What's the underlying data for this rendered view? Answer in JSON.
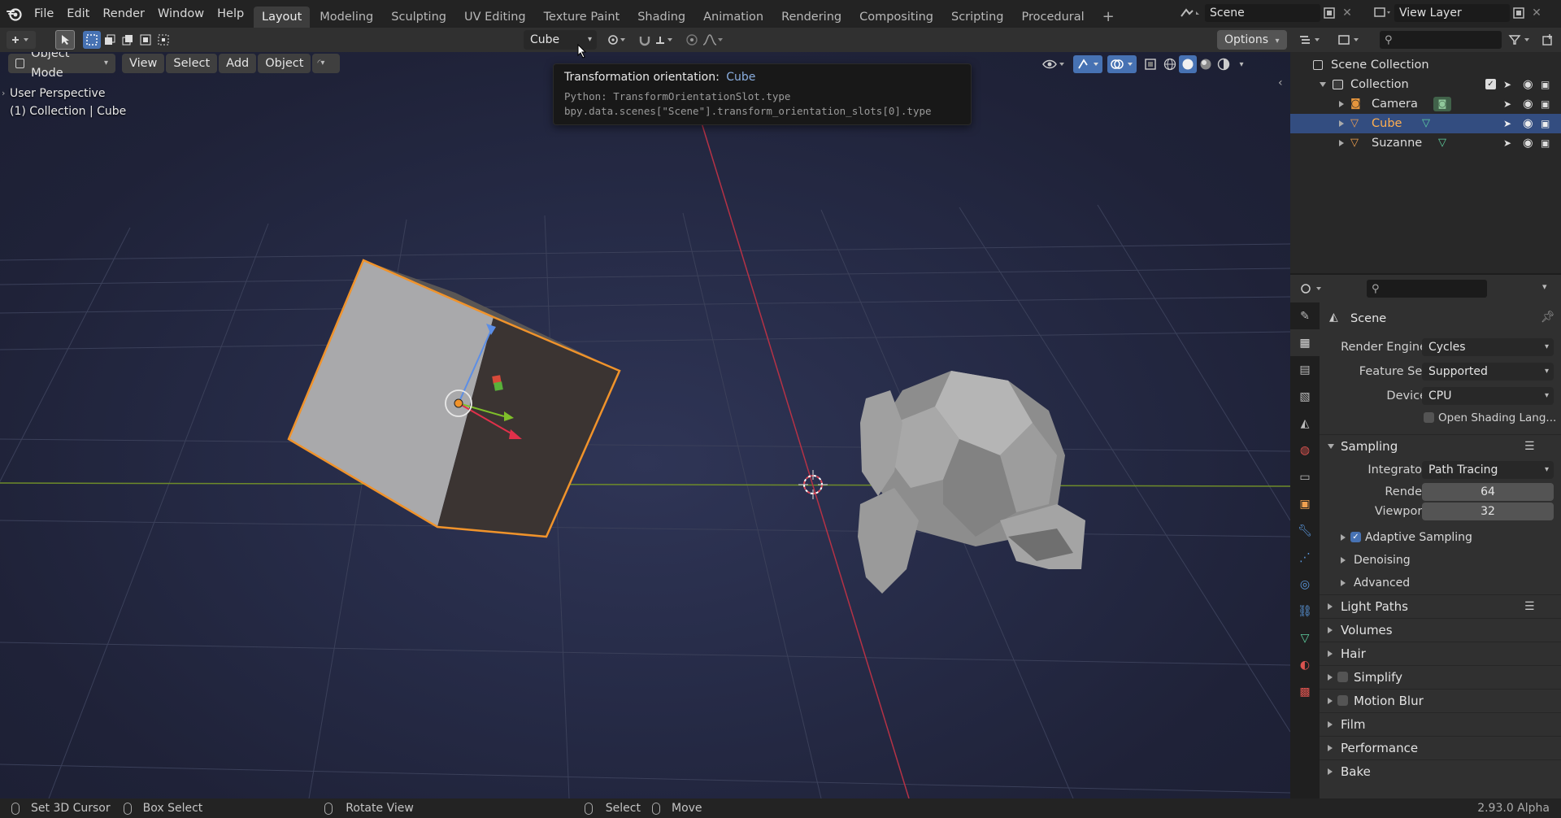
{
  "app": {
    "logo": "blender-logo-icon"
  },
  "menu": [
    "File",
    "Edit",
    "Render",
    "Window",
    "Help"
  ],
  "workspaces": [
    "Layout",
    "Modeling",
    "Sculpting",
    "UV Editing",
    "Texture Paint",
    "Shading",
    "Animation",
    "Rendering",
    "Compositing",
    "Scripting",
    "Procedural"
  ],
  "active_workspace": "Layout",
  "scene_field": "Scene",
  "view_layer_field": "View Layer",
  "toolheader": {
    "orientation_value": "Cube",
    "options_label": "Options"
  },
  "viewport_header": {
    "mode": "Object Mode",
    "menus": [
      "View",
      "Select",
      "Add",
      "Object"
    ]
  },
  "viewport": {
    "perspective": "User Perspective",
    "context": "(1) Collection | Cube"
  },
  "tooltip": {
    "title": "Transformation orientation:",
    "value": "Cube",
    "python_line1": "Python: TransformOrientationSlot.type",
    "python_line2": "bpy.data.scenes[\"Scene\"].transform_orientation_slots[0].type"
  },
  "outliner": {
    "root": "Scene Collection",
    "collection": "Collection",
    "items": [
      {
        "name": "Camera",
        "icon": "camera-icon",
        "data_icon": "camera-data-icon",
        "selected": false
      },
      {
        "name": "Cube",
        "icon": "mesh-object-icon",
        "data_icon": "mesh-data-icon",
        "selected": true
      },
      {
        "name": "Suzanne",
        "icon": "mesh-object-icon",
        "data_icon": "mesh-data-icon",
        "selected": false
      }
    ]
  },
  "properties": {
    "context_title": "Scene",
    "render_engine_label": "Render Engine",
    "render_engine": "Cycles",
    "feature_set_label": "Feature Set",
    "feature_set": "Supported",
    "device_label": "Device",
    "device": "CPU",
    "osl_label": "Open Shading Lang...",
    "sampling": "Sampling",
    "integrator_label": "Integrator",
    "integrator": "Path Tracing",
    "render_label": "Render",
    "render_samples": "64",
    "viewport_label": "Viewport",
    "viewport_samples": "32",
    "adaptive": "Adaptive Sampling",
    "denoising": "Denoising",
    "advanced": "Advanced",
    "panels": [
      "Light Paths",
      "Volumes",
      "Hair",
      "Simplify",
      "Motion Blur",
      "Film",
      "Performance",
      "Bake"
    ]
  },
  "statusbar": {
    "set_cursor": "Set 3D Cursor",
    "box_select": "Box Select",
    "rotate_view": "Rotate View",
    "select": "Select",
    "move": "Move",
    "version": "2.93.0 Alpha"
  },
  "colors": {
    "accent_selected": "#334d80",
    "outline_selected": "#f0932b",
    "x_axis": "#c0364a",
    "y_axis": "#7aa22a"
  }
}
